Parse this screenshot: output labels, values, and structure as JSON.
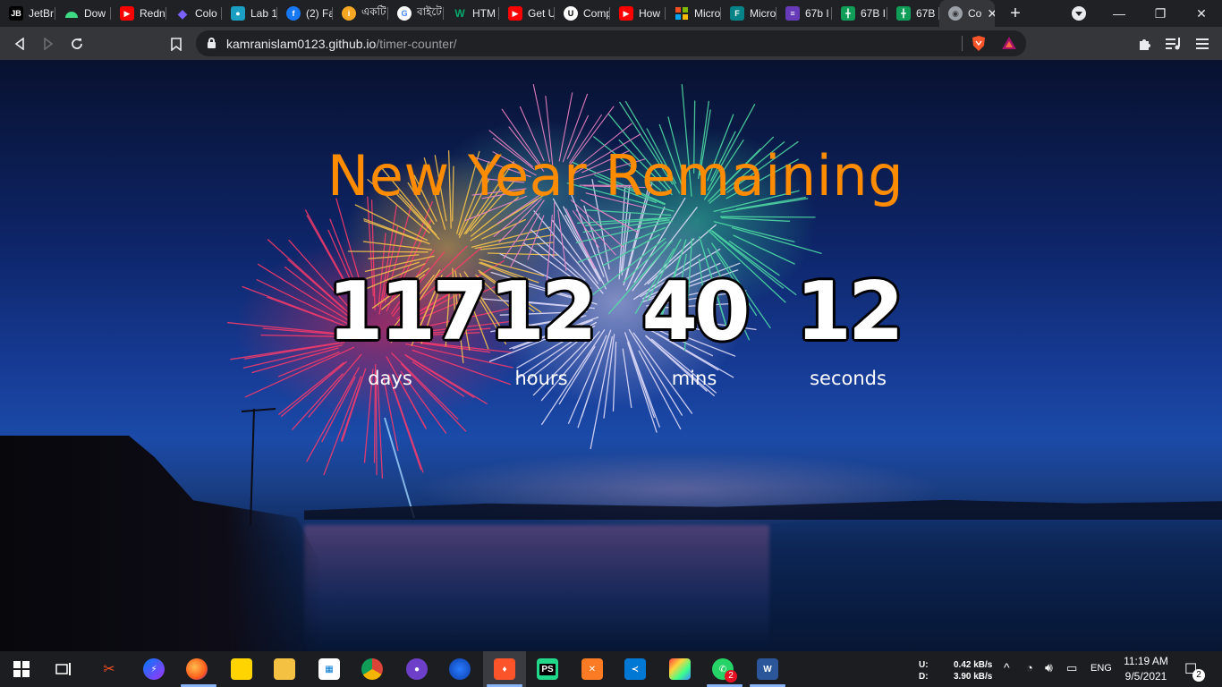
{
  "browser": {
    "tabs": [
      {
        "label": "JetBr",
        "icon": "jetbrains-icon",
        "color": "#000000"
      },
      {
        "label": "Dow",
        "icon": "android-icon",
        "color": "#3ddc84"
      },
      {
        "label": "Redn",
        "icon": "youtube-icon",
        "color": "#ff0000"
      },
      {
        "label": "Colo",
        "icon": "color-icon",
        "color": "#7b61ff"
      },
      {
        "label": "Lab 1",
        "icon": "classroom-icon",
        "color": "#1a73e8"
      },
      {
        "label": "(2) Fa",
        "icon": "facebook-icon",
        "color": "#1877f2"
      },
      {
        "label": "একটি",
        "icon": "info-icon",
        "color": "#f5a623"
      },
      {
        "label": "বাইটে",
        "icon": "google-icon",
        "color": "#ffffff"
      },
      {
        "label": "HTM",
        "icon": "w3schools-icon",
        "color": "#04aa6d"
      },
      {
        "label": "Get U",
        "icon": "youtube-icon",
        "color": "#ff0000"
      },
      {
        "label": "Comp",
        "icon": "udemy-icon",
        "color": "#ffffff"
      },
      {
        "label": "How",
        "icon": "youtube-icon",
        "color": "#ff0000"
      },
      {
        "label": "Micro",
        "icon": "microsoft-icon",
        "color": "#f25022"
      },
      {
        "label": "Micro",
        "icon": "forms-icon",
        "color": "#038387"
      },
      {
        "label": "67b I",
        "icon": "list-icon",
        "color": "#673ab7"
      },
      {
        "label": "67B I",
        "icon": "sheets-icon",
        "color": "#0f9d58"
      },
      {
        "label": "67B I",
        "icon": "sheets-icon",
        "color": "#0f9d58"
      },
      {
        "label": "Co",
        "icon": "globe-icon",
        "color": "#9aa0a6"
      }
    ],
    "url_host": "kamranislam0123.github.io",
    "url_path": "/timer-counter/"
  },
  "page": {
    "title": "New Year Remaining",
    "countdown": [
      {
        "value": "117",
        "label": "days"
      },
      {
        "value": "12",
        "label": "hours"
      },
      {
        "value": "40",
        "label": "mins"
      },
      {
        "value": "12",
        "label": "seconds"
      }
    ],
    "title_color": "#ff8c00"
  },
  "taskbar": {
    "net_up_label": "U:",
    "net_down_label": "D:",
    "net_up": "0.42 kB/s",
    "net_down": "3.90 kB/s",
    "language": "ENG",
    "time": "11:19 AM",
    "date": "9/5/2021",
    "whatsapp_badge": "2",
    "notification_count": "2"
  }
}
